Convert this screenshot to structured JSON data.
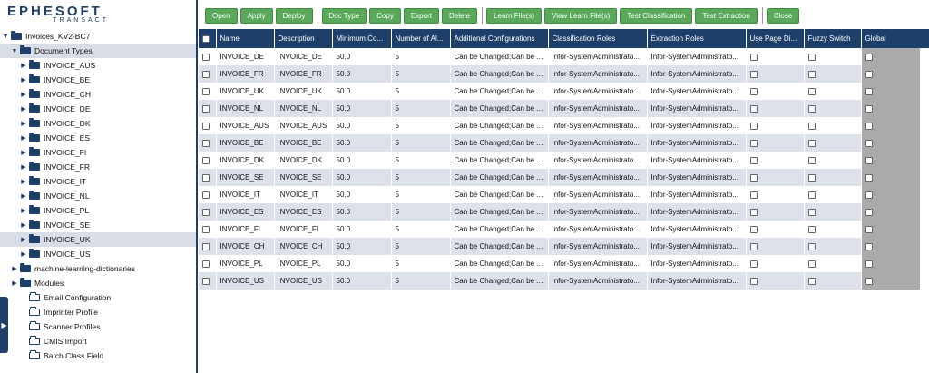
{
  "logo": {
    "main": "EPHESOFT",
    "sub": "TRANSACT"
  },
  "toolbar": {
    "groups": [
      [
        "Open",
        "Apply",
        "Deploy"
      ],
      [
        "Doc Type",
        "Copy",
        "Export",
        "Delete"
      ],
      [
        "Learn File(s)",
        "View Learn File(s)",
        "Test Classification",
        "Test Extraction"
      ],
      [
        "Close"
      ]
    ]
  },
  "tree": {
    "root": "Invoices_KV2-BC7",
    "document_types": "Document Types",
    "doc_types": [
      "INVOICE_AUS",
      "INVOICE_BE",
      "INVOICE_CH",
      "INVOICE_DE",
      "INVOICE_DK",
      "INVOICE_ES",
      "INVOICE_FI",
      "INVOICE_FR",
      "INVOICE_IT",
      "INVOICE_NL",
      "INVOICE_PL",
      "INVOICE_SE",
      "INVOICE_UK",
      "INVOICE_US"
    ],
    "selected": "INVOICE_UK",
    "closed_groups": [
      "machine-learning-dictionaries",
      "Modules"
    ],
    "leaves": [
      "Email Configuration",
      "Imprinter Profile",
      "Scanner Profiles",
      "CMIS Import",
      "Batch Class Field"
    ]
  },
  "grid": {
    "columns": [
      "Name",
      "Description",
      "Minimum Co...",
      "Number of Al...",
      "Additional Configurations",
      "Classification Roles",
      "Extraction Roles",
      "Use Page Di...",
      "Fuzzy Switch",
      "Global"
    ],
    "rows": [
      [
        "INVOICE_DE",
        "INVOICE_DE",
        "50.0",
        "5",
        "Can be Changed;Can be A...",
        "Infor-SystemAdministrato...",
        "Infor-SystemAdministrato..."
      ],
      [
        "INVOICE_FR",
        "INVOICE_FR",
        "50.0",
        "5",
        "Can be Changed;Can be A...",
        "Infor-SystemAdministrato...",
        "Infor-SystemAdministrato..."
      ],
      [
        "INVOICE_UK",
        "INVOICE_UK",
        "50.0",
        "5",
        "Can be Changed;Can be A...",
        "Infor-SystemAdministrato...",
        "Infor-SystemAdministrato..."
      ],
      [
        "INVOICE_NL",
        "INVOICE_NL",
        "50.0",
        "5",
        "Can be Changed;Can be A...",
        "Infor-SystemAdministrato...",
        "Infor-SystemAdministrato..."
      ],
      [
        "INVOICE_AUS",
        "INVOICE_AUS",
        "50.0",
        "5",
        "Can be Changed;Can be A...",
        "Infor-SystemAdministrato...",
        "Infor-SystemAdministrato..."
      ],
      [
        "INVOICE_BE",
        "INVOICE_BE",
        "50.0",
        "5",
        "Can be Changed;Can be A...",
        "Infor-SystemAdministrato...",
        "Infor-SystemAdministrato..."
      ],
      [
        "INVOICE_DK",
        "INVOICE_DK",
        "50.0",
        "5",
        "Can be Changed;Can be A...",
        "Infor-SystemAdministrato...",
        "Infor-SystemAdministrato..."
      ],
      [
        "INVOICE_SE",
        "INVOICE_SE",
        "50.0",
        "5",
        "Can be Changed;Can be A...",
        "Infor-SystemAdministrato...",
        "Infor-SystemAdministrato..."
      ],
      [
        "INVOICE_IT",
        "INVOICE_IT",
        "50.0",
        "5",
        "Can be Changed;Can be A...",
        "Infor-SystemAdministrato...",
        "Infor-SystemAdministrato..."
      ],
      [
        "INVOICE_ES",
        "INVOICE_ES",
        "50.0",
        "5",
        "Can be Changed;Can be A...",
        "Infor-SystemAdministrato...",
        "Infor-SystemAdministrato..."
      ],
      [
        "INVOICE_FI",
        "INVOICE_FI",
        "50.0",
        "5",
        "Can be Changed;Can be A...",
        "Infor-SystemAdministrato...",
        "Infor-SystemAdministrato..."
      ],
      [
        "INVOICE_CH",
        "INVOICE_CH",
        "50.0",
        "5",
        "Can be Changed;Can be A...",
        "Infor-SystemAdministrato...",
        "Infor-SystemAdministrato..."
      ],
      [
        "INVOICE_PL",
        "INVOICE_PL",
        "50.0",
        "5",
        "Can be Changed;Can be A...",
        "Infor-SystemAdministrato...",
        "Infor-SystemAdministrato..."
      ],
      [
        "INVOICE_US",
        "INVOICE_US",
        "50.0",
        "5",
        "Can be Changed;Can be A...",
        "Infor-SystemAdministrato...",
        "Infor-SystemAdministrato..."
      ]
    ]
  },
  "colors": {
    "brand": "#1f3f6b",
    "button": "#5aa85a",
    "row_alt": "#dde1ea",
    "global_cell": "#aaaaaa"
  },
  "icons": {
    "expanded": "caret-down-icon",
    "collapsed": "caret-right-icon",
    "folder": "folder-icon"
  }
}
